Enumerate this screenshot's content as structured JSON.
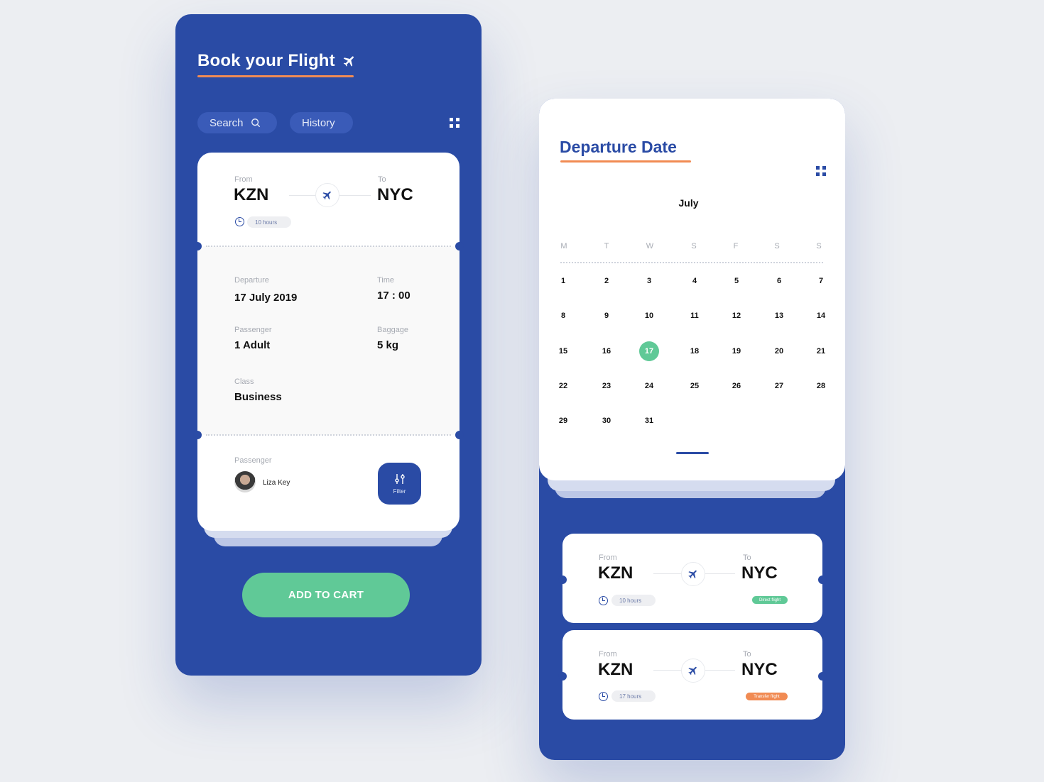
{
  "left": {
    "title": "Book your Flight",
    "search_label": "Search",
    "history_label": "History",
    "ticket": {
      "from_label": "From",
      "from_code": "KZN",
      "to_label": "To",
      "to_code": "NYC",
      "duration": "10 hours",
      "departure_label": "Departure",
      "departure_value": "17 July 2019",
      "time_label": "Time",
      "time_value": "17 : 00",
      "passenger_label": "Passenger",
      "passenger_value": "1 Adult",
      "baggage_label": "Baggage",
      "baggage_value": "5 kg",
      "class_label": "Class",
      "class_value": "Business",
      "passenger2_label": "Passenger",
      "passenger_name": "Liza Key",
      "filter_label": "Filter"
    },
    "cart_label": "ADD TO CART"
  },
  "right": {
    "title": "Departure Date",
    "month": "July",
    "weekdays": [
      "M",
      "T",
      "W",
      "S",
      "F",
      "S",
      "S"
    ],
    "selected_day": 17,
    "weeks": [
      [
        "1",
        "2",
        "3",
        "4",
        "5",
        "6",
        "7"
      ],
      [
        "8",
        "9",
        "10",
        "11",
        "12",
        "13",
        "14"
      ],
      [
        "15",
        "16",
        "17",
        "18",
        "19",
        "20",
        "21"
      ],
      [
        "22",
        "23",
        "24",
        "25",
        "26",
        "27",
        "28"
      ],
      [
        "29",
        "30",
        "31"
      ]
    ],
    "flights": [
      {
        "from_label": "From",
        "from_code": "KZN",
        "to_label": "To",
        "to_code": "NYC",
        "duration": "10 hours",
        "tag": "Direct flight"
      },
      {
        "from_label": "From",
        "from_code": "KZN",
        "to_label": "To",
        "to_code": "NYC",
        "duration": "17 hours",
        "tag": "Transfer flight"
      }
    ]
  },
  "colors": {
    "primary": "#2a4ba5",
    "accent_orange": "#f18b53",
    "accent_green": "#60c997",
    "background": "#eceef2"
  },
  "icons": [
    "plane-icon",
    "search-icon",
    "grid-menu-icon",
    "clock-icon",
    "filter-sliders-icon"
  ]
}
